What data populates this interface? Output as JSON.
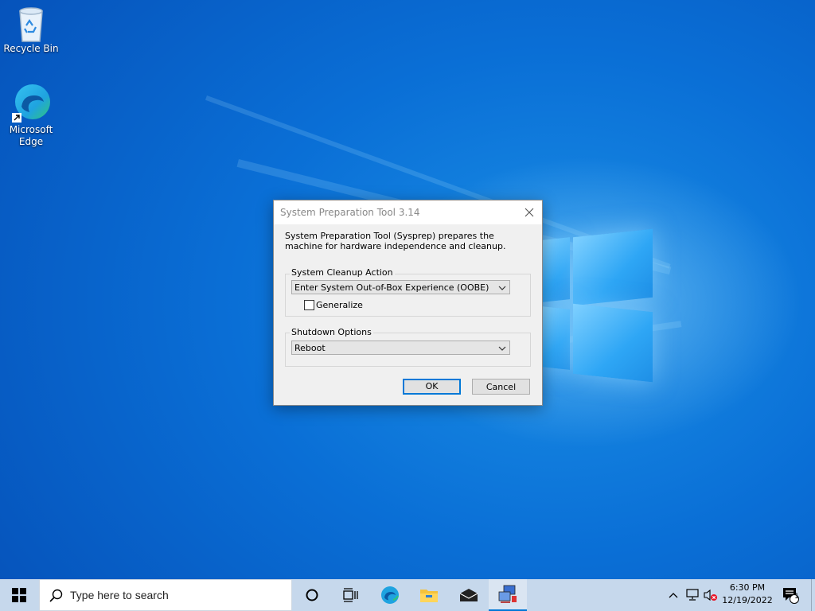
{
  "desktop": {
    "icons": [
      {
        "label": "Recycle Bin"
      },
      {
        "label": "Microsoft Edge"
      }
    ]
  },
  "dialog": {
    "title": "System Preparation Tool 3.14",
    "description": "System Preparation Tool (Sysprep) prepares the machine for hardware independence and cleanup.",
    "cleanup_group_label": "System Cleanup Action",
    "cleanup_action_value": "Enter System Out-of-Box Experience (OOBE)",
    "generalize_label": "Generalize",
    "generalize_checked": false,
    "shutdown_group_label": "Shutdown Options",
    "shutdown_value": "Reboot",
    "ok_label": "OK",
    "cancel_label": "Cancel"
  },
  "taskbar": {
    "search_placeholder": "Type here to search",
    "time": "6:30 PM",
    "date": "12/19/2022",
    "notification_count": "1"
  },
  "colors": {
    "accent": "#0078d7",
    "taskbar": "#c6d8ec"
  }
}
